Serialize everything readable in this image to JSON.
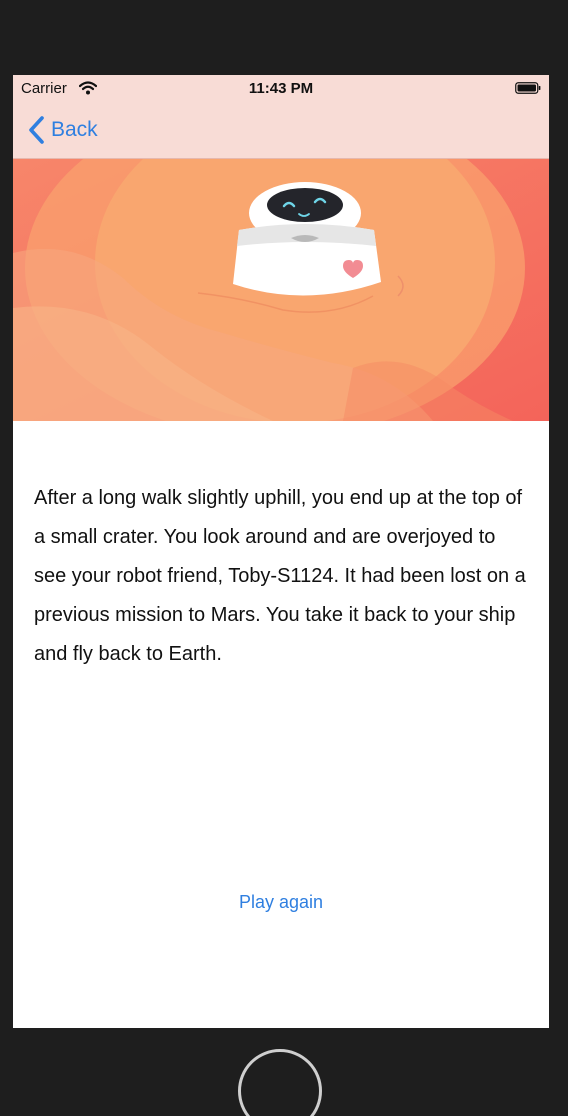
{
  "status_bar": {
    "carrier": "Carrier",
    "time": "11:43 PM",
    "icons": [
      "wifi-icon",
      "battery-icon"
    ]
  },
  "nav_bar": {
    "back_label": "Back",
    "back_icon": "chevron-left-icon"
  },
  "hero": {
    "description": "robot-on-mars-illustration"
  },
  "story": {
    "text": "After a long walk slightly uphill, you end up at the top of a small crater. You look around and are overjoyed to see your robot friend, Toby-S1124. It had been lost on a previous mission to Mars. You take it back to your ship and fly back to Earth."
  },
  "actions": {
    "play_again_label": "Play again"
  },
  "colors": {
    "accent": "#2f7fe0",
    "nav_background": "#f8dcd6",
    "device_frame": "#1e1e1e",
    "mars_light": "#f9a46e",
    "mars_dark": "#f46a5c"
  }
}
